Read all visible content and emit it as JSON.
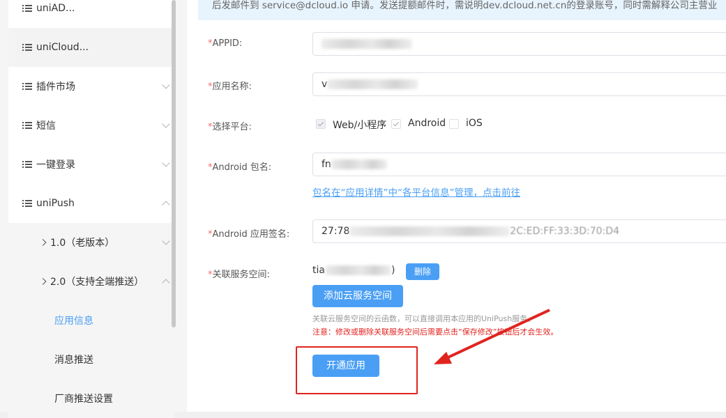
{
  "sidebar": {
    "items": [
      {
        "label": "uniAD..."
      },
      {
        "label": "uniCloud..."
      },
      {
        "label": "插件市场"
      },
      {
        "label": "短信"
      },
      {
        "label": "一键登录"
      },
      {
        "label": "uniPush"
      }
    ],
    "sub_items": [
      {
        "label": "1.0（老版本）"
      },
      {
        "label": "2.0（支持全端推送）"
      }
    ],
    "leaf_items": [
      {
        "label": "应用信息",
        "selected": true
      },
      {
        "label": "消息推送"
      },
      {
        "label": "厂商推送设置"
      }
    ]
  },
  "notice": {
    "text": "后发邮件到 service@dcloud.io 申请。发送提额邮件时，需说明dev.dcloud.net.cn的登录账号，同时需解释公司主营业"
  },
  "form": {
    "required_mark": "*",
    "appid_label": "APPID:",
    "app_name_label": "应用名称:",
    "app_name_value": "v",
    "platform_label": "选择平台:",
    "platforms": [
      {
        "label": "Web/小程序",
        "checked": true,
        "disabled": true
      },
      {
        "label": "Android",
        "checked": true,
        "disabled": false
      },
      {
        "label": "iOS",
        "checked": false,
        "disabled": false
      }
    ],
    "android_pkg_label": "Android 包名:",
    "android_pkg_value": "fn",
    "pkg_link": "包名在“应用详情”中“各平台信息”管理，点击前往",
    "android_sig_label": "Android 应用签名:",
    "android_sig_prefix": "27:78",
    "android_sig_suffix": "2C:ED:FF:33:3D:70:D4",
    "service_space_label": "关联服务空间:",
    "service_space_value_prefix": "tia",
    "service_space_value_suffix": ")",
    "delete_button": "删除",
    "add_space_button": "添加云服务空间",
    "tip_gray": "关联云服务空间的云函数，可以直接调用本应用的UniPush服务。",
    "tip_red": "注意：修改或删除关联服务空间后需要点击“保存修改”按钮后才会生效。",
    "enable_button": "开通应用"
  },
  "colors": {
    "accent": "#4a9ff5",
    "required": "#f56c6c",
    "warning_text": "#e0241f",
    "annotation": "#e0241f"
  }
}
